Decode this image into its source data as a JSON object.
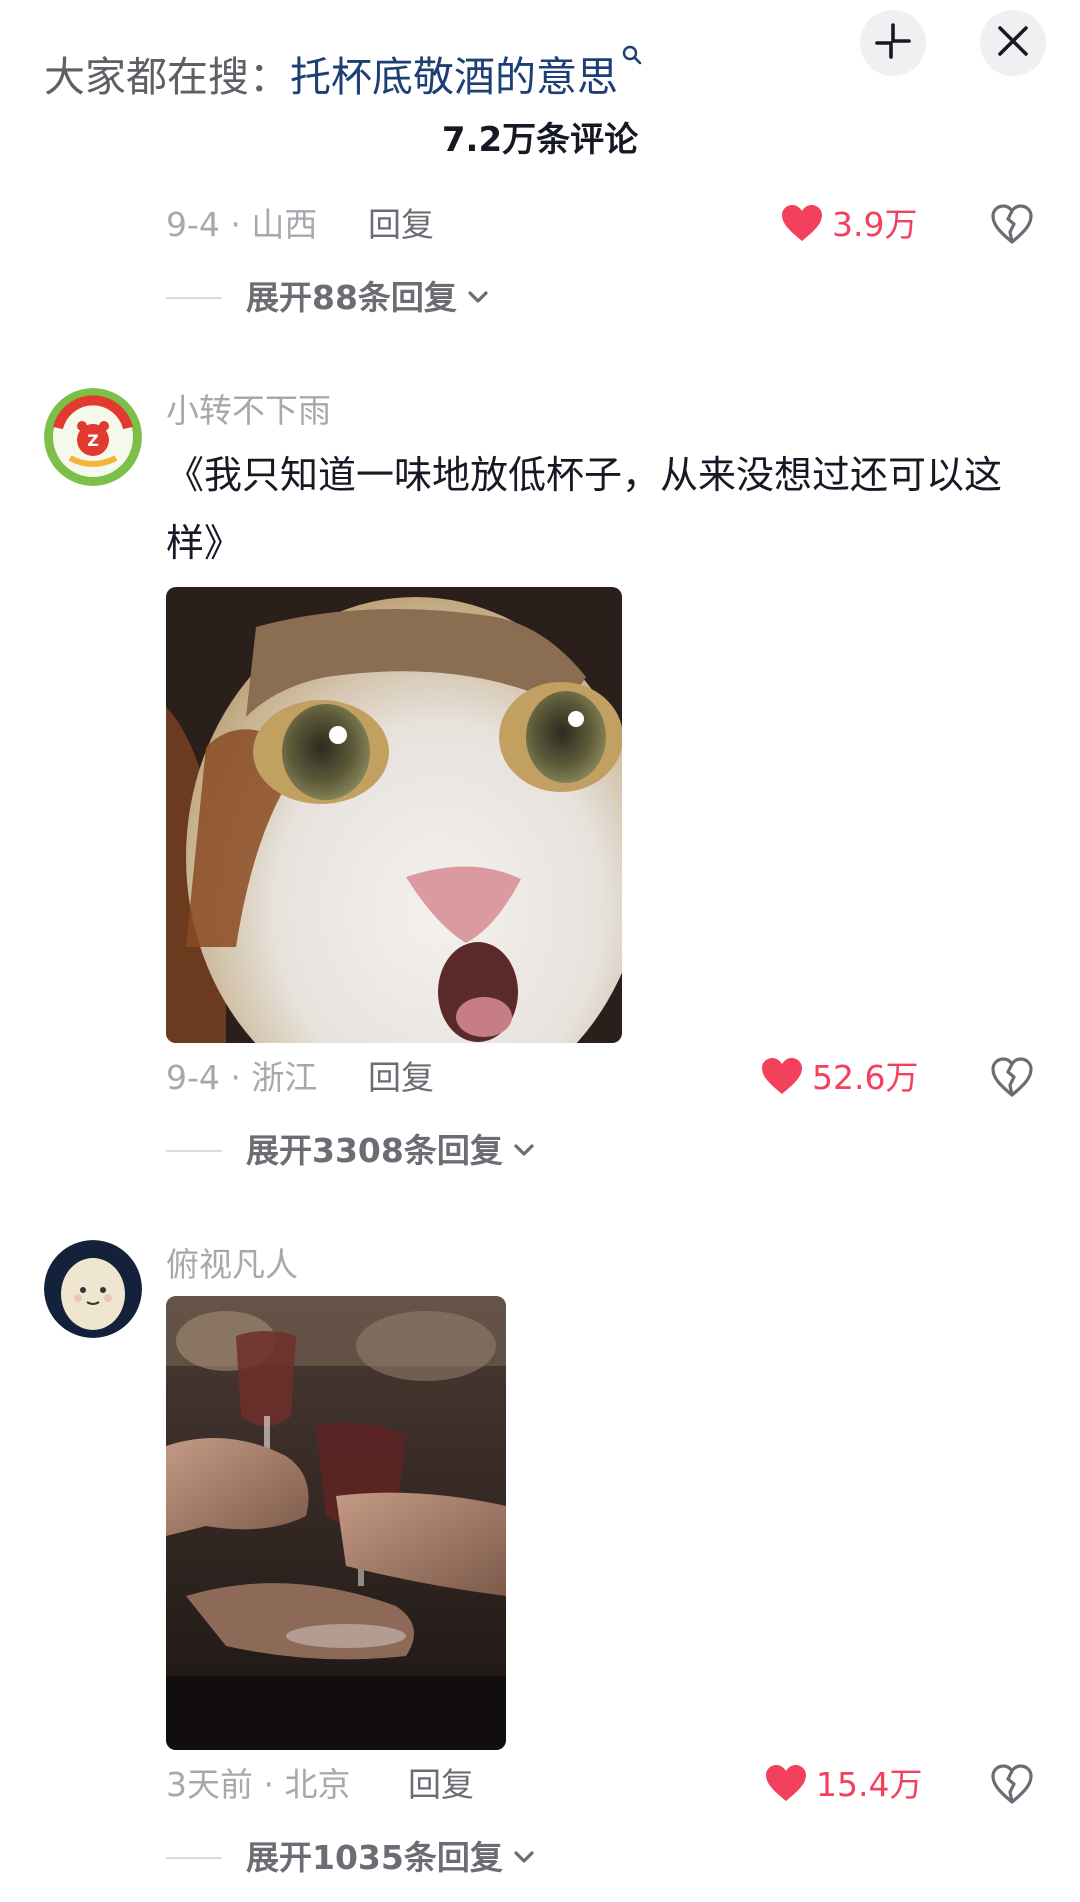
{
  "header": {
    "search_prefix": "大家都在搜：",
    "search_query": "托杯底敬酒的意思",
    "comment_count": "7.2万条评论"
  },
  "icons": {
    "search": "magnifier-icon",
    "collapse": "collapse-icon",
    "close": "close-icon",
    "like": "heart-icon",
    "dislike": "broken-heart-icon",
    "expand": "chevron-down-icon"
  },
  "colors": {
    "accent_like": "#f2405d",
    "query_link": "#1e3f74",
    "secondary_text": "#a7a8ae"
  },
  "comments": [
    {
      "date_location": "9-4 · 山西",
      "reply_label": "回复",
      "likes": "3.9万",
      "expand_label": "展开88条回复"
    },
    {
      "username": "小转不下雨",
      "text": "《我只知道一味地放低杯子，从来没想过还可以这样》",
      "media_desc": "cat meme",
      "date_location": "9-4 · 浙江",
      "reply_label": "回复",
      "likes": "52.6万",
      "expand_label": "展开3308条回复"
    },
    {
      "username": "俯视凡人",
      "media_desc": "wine glass toast",
      "date_location": "3天前 · 北京",
      "reply_label": "回复",
      "likes": "15.4万",
      "expand_label": "展开1035条回复"
    }
  ]
}
